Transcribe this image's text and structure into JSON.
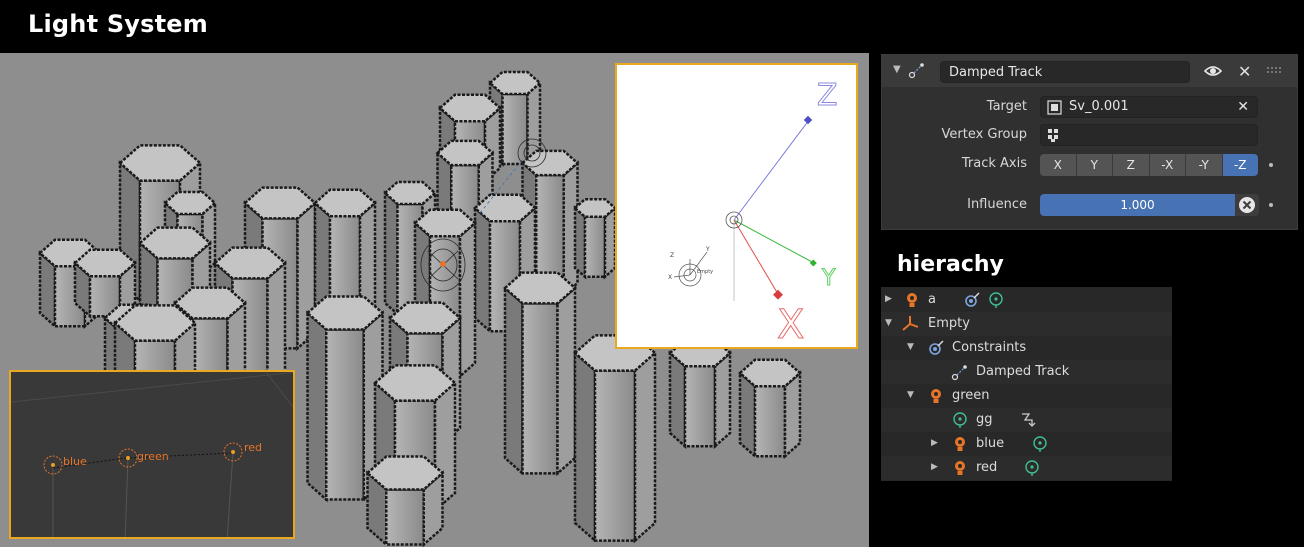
{
  "heading": "Light System",
  "hierarchy_heading": "hierachy",
  "colors": {
    "accent_blue": "#4772b3",
    "light_orange": "#e8742a",
    "inset_border": "#e8a820"
  },
  "inset_axes": {
    "z": "Z",
    "y": "Y",
    "x": "X",
    "small_z": "Z",
    "small_y": "Y",
    "small_x": "X",
    "small_empty": "Empty"
  },
  "inset_lights": {
    "blue": "blue",
    "green": "green",
    "red": "red"
  },
  "constraint": {
    "name": "Damped Track",
    "target_label": "Target",
    "target_value": "Sv_0.001",
    "vertex_group_label": "Vertex Group",
    "vertex_group_value": "",
    "track_axis_label": "Track Axis",
    "axes": [
      "X",
      "Y",
      "Z",
      "-X",
      "-Y",
      "-Z"
    ],
    "track_axis_selected": "-Z",
    "influence_label": "Influence",
    "influence_value": "1.000",
    "influence": 1.0
  },
  "outliner": {
    "rows": [
      {
        "label": "a",
        "icon": "light-icon"
      },
      {
        "label": "Empty",
        "icon": "empty-icon"
      },
      {
        "label": "Constraints",
        "icon": "constraint-icon"
      },
      {
        "label": "Damped Track",
        "icon": "damped-track-icon"
      },
      {
        "label": "green",
        "icon": "light-icon"
      },
      {
        "label": "gg",
        "icon": "light-data-icon"
      },
      {
        "label": "blue",
        "icon": "light-icon"
      },
      {
        "label": "red",
        "icon": "light-icon"
      }
    ]
  }
}
